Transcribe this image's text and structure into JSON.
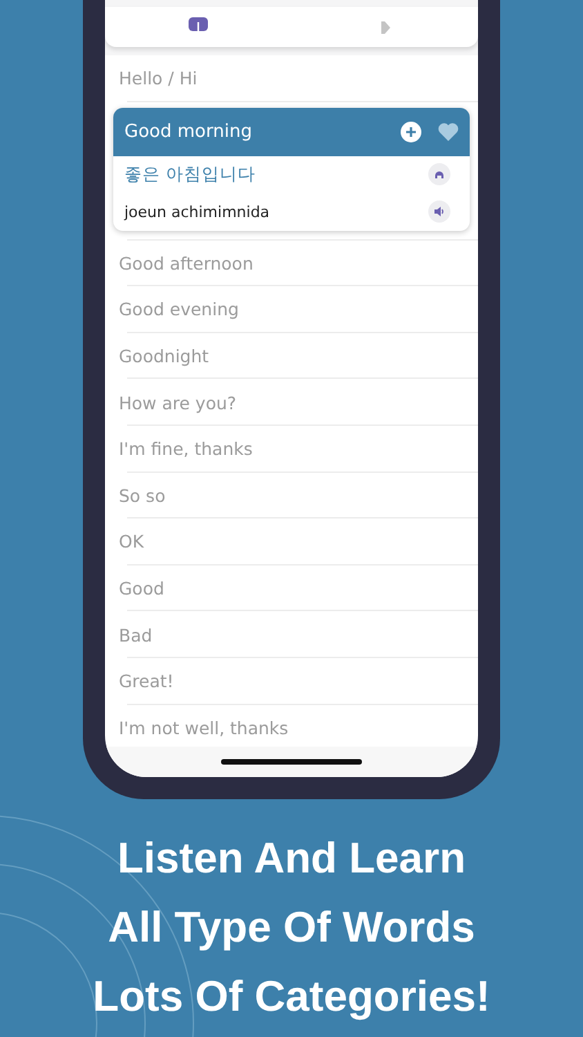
{
  "tabs": [
    {
      "kind": "download",
      "selected": true
    },
    {
      "kind": "play",
      "selected": false
    }
  ],
  "phrases": [
    {
      "text": "Hello / Hi",
      "expanded": false
    },
    {
      "text": "Good morning",
      "expanded": true,
      "favorite": false,
      "translation": "좋은 아침입니다",
      "romanization": "joeun achimimnida"
    },
    {
      "text": "Good afternoon",
      "expanded": false
    },
    {
      "text": "Good evening",
      "expanded": false
    },
    {
      "text": "Goodnight",
      "expanded": false
    },
    {
      "text": "How are you?",
      "expanded": false
    },
    {
      "text": "I'm fine, thanks",
      "expanded": false
    },
    {
      "text": "So so",
      "expanded": false
    },
    {
      "text": "OK",
      "expanded": false
    },
    {
      "text": "Good",
      "expanded": false
    },
    {
      "text": "Bad",
      "expanded": false
    },
    {
      "text": "Great!",
      "expanded": false
    },
    {
      "text": "I'm not well, thanks",
      "expanded": false
    }
  ],
  "headline": [
    "Listen And Learn",
    "All Type Of Words",
    "Lots Of Categories!"
  ]
}
